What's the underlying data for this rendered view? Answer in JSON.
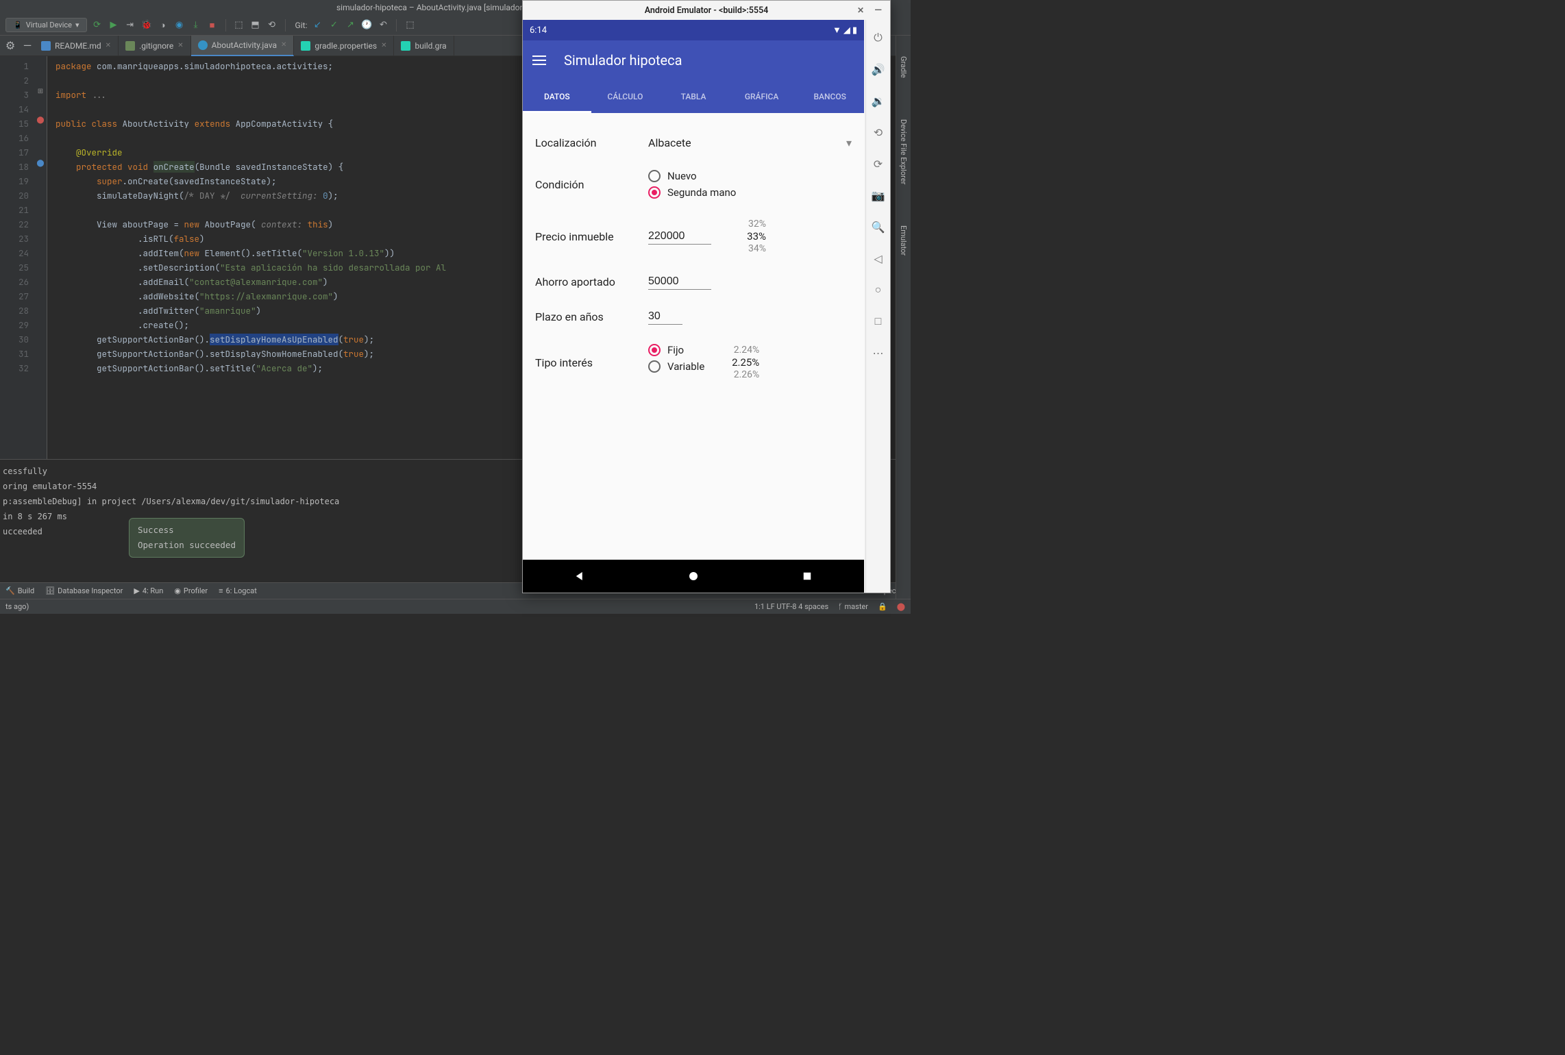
{
  "ide": {
    "title": "simulador-hipoteca – AboutActivity.java [simulador-hipoteca.ap...",
    "device": "Virtual Device",
    "git_label": "Git:",
    "tabs": [
      {
        "label": "README.md",
        "icon": "md"
      },
      {
        "label": ".gitignore",
        "icon": "gitig"
      },
      {
        "label": "AboutActivity.java",
        "icon": "java",
        "active": true
      },
      {
        "label": "gradle.properties",
        "icon": "gradle"
      },
      {
        "label": "build.gra",
        "icon": "gradle"
      }
    ],
    "gutter_lines": [
      "1",
      "2",
      "3",
      "14",
      "15",
      "16",
      "17",
      "18",
      "19",
      "20",
      "21",
      "22",
      "23",
      "24",
      "25",
      "26",
      "27",
      "28",
      "29",
      "30",
      "31",
      "32"
    ],
    "console": [
      "cessfully",
      "",
      "oring emulator-5554",
      "",
      "p:assembleDebug] in project /Users/alexma/dev/git/simulador-hipoteca",
      "",
      " in 8 s 267 ms",
      "",
      "ucceeded"
    ],
    "balloon_title": "Success",
    "balloon_msg": "Operation succeeded",
    "bottom_tabs": [
      "Build",
      "Database Inspector",
      "4: Run",
      "Profiler",
      "6: Logcat"
    ],
    "status_right_inspector": "Inspector",
    "status_left": "ts ago)",
    "status_meta": "1:1  LF  UTF-8  4 spaces",
    "status_branch": "master",
    "right_tools": [
      "Gradle",
      "Device File Explorer",
      "Emulator"
    ]
  },
  "emu": {
    "title": "Android Emulator - <build>:5554",
    "time": "6:14",
    "app_title": "Simulador hipoteca",
    "tabs": [
      "DATOS",
      "CÁLCULO",
      "TABLA",
      "GRÁFICA",
      "BANCOS"
    ],
    "loc_label": "Localización",
    "loc_value": "Albacete",
    "cond_label": "Condición",
    "cond_opts": [
      "Nuevo",
      "Segunda mano"
    ],
    "price_label": "Precio inmueble",
    "price_value": "220000",
    "price_pct": [
      "32%",
      "33%",
      "34%"
    ],
    "savings_label": "Ahorro aportado",
    "savings_value": "50000",
    "term_label": "Plazo en años",
    "term_value": "30",
    "rate_label": "Tipo interés",
    "rate_opts": [
      "Fijo",
      "Variable"
    ],
    "rate_pct": [
      "2.24%",
      "2.25%",
      "2.26%"
    ]
  }
}
